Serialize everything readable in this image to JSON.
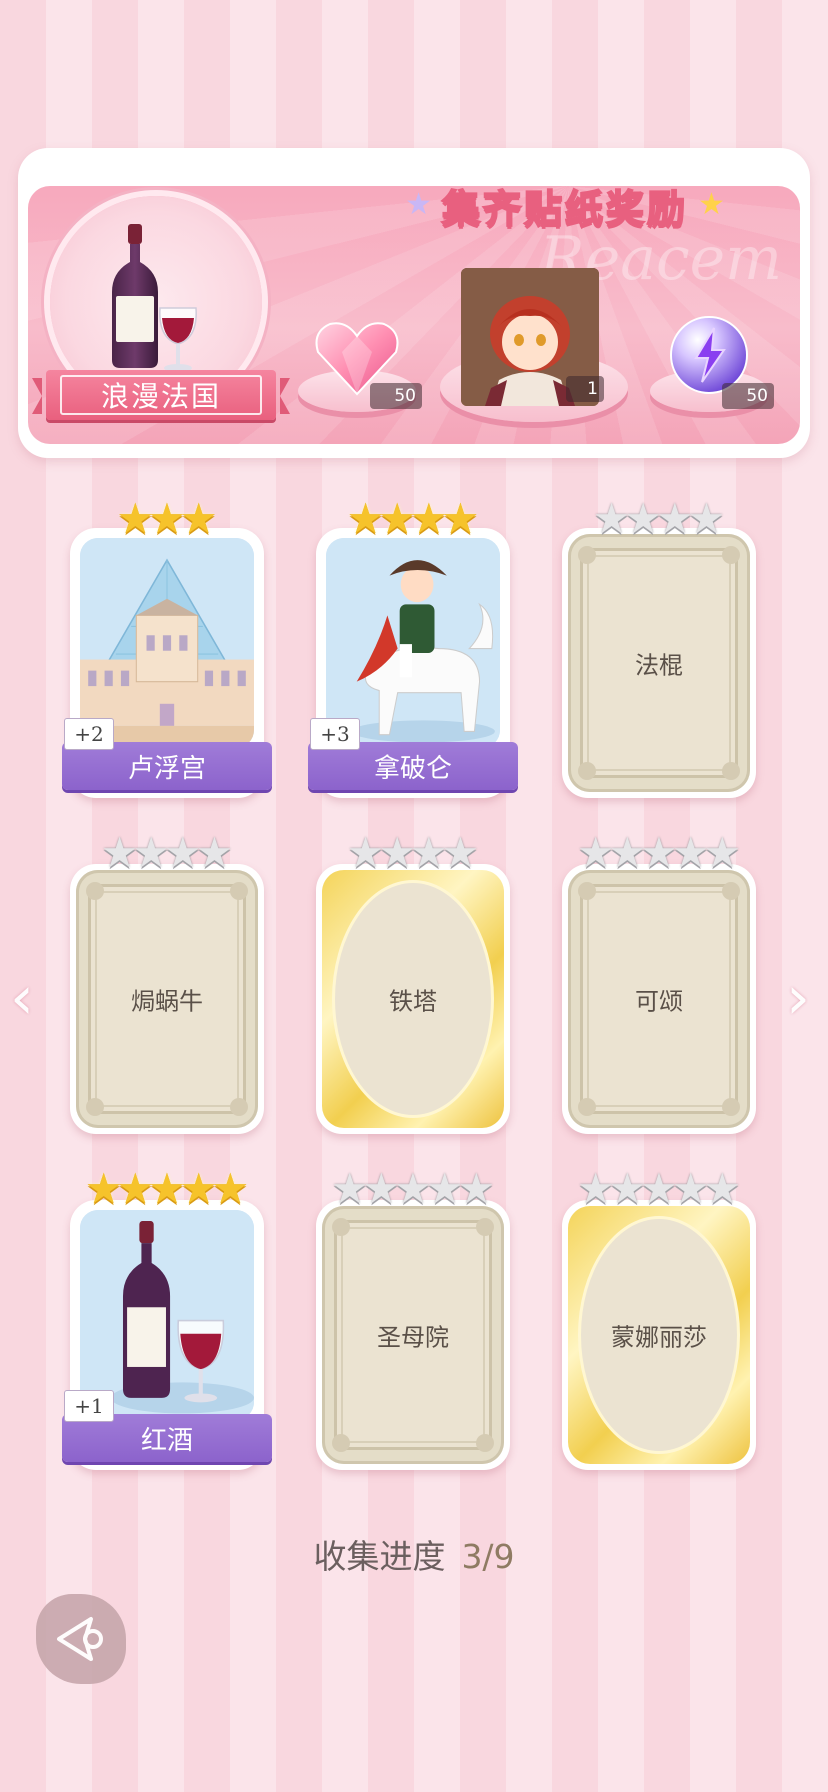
{
  "banner": {
    "title": "集齐贴纸奖励",
    "theme": "浪漫法国",
    "watermark": "Reacem",
    "rewards": [
      {
        "icon": "pink-heart-gem-icon",
        "qty": "50"
      },
      {
        "icon": "character-portrait",
        "qty": "1"
      },
      {
        "icon": "purple-lightning-orb-icon",
        "qty": "50"
      }
    ]
  },
  "cards": [
    {
      "name": "卢浮宫",
      "stars_total": 3,
      "stars_filled": 3,
      "collected": true,
      "dup": "+2",
      "art": "louvre"
    },
    {
      "name": "拿破仑",
      "stars_total": 4,
      "stars_filled": 4,
      "collected": true,
      "dup": "+3",
      "art": "napoleon"
    },
    {
      "name": "法棍",
      "stars_total": 4,
      "stars_filled": 0,
      "collected": false,
      "frame": "plain"
    },
    {
      "name": "焗蜗牛",
      "stars_total": 4,
      "stars_filled": 0,
      "collected": false,
      "frame": "plain"
    },
    {
      "name": "铁塔",
      "stars_total": 4,
      "stars_filled": 0,
      "collected": false,
      "frame": "gold"
    },
    {
      "name": "可颂",
      "stars_total": 5,
      "stars_filled": 0,
      "collected": false,
      "frame": "plain"
    },
    {
      "name": "红酒",
      "stars_total": 5,
      "stars_filled": 5,
      "collected": true,
      "dup": "+1",
      "art": "wine"
    },
    {
      "name": "圣母院",
      "stars_total": 5,
      "stars_filled": 0,
      "collected": false,
      "frame": "plain"
    },
    {
      "name": "蒙娜丽莎",
      "stars_total": 5,
      "stars_filled": 0,
      "collected": false,
      "frame": "gold"
    }
  ],
  "progress": {
    "label": "收集进度",
    "value": "3/9"
  },
  "nav": {
    "prev": "‹",
    "next": "›"
  },
  "colors": {
    "accent_pink": "#e8607f",
    "ribbon_purple": "#8c63cc",
    "star_gold": "#f6c32b"
  }
}
